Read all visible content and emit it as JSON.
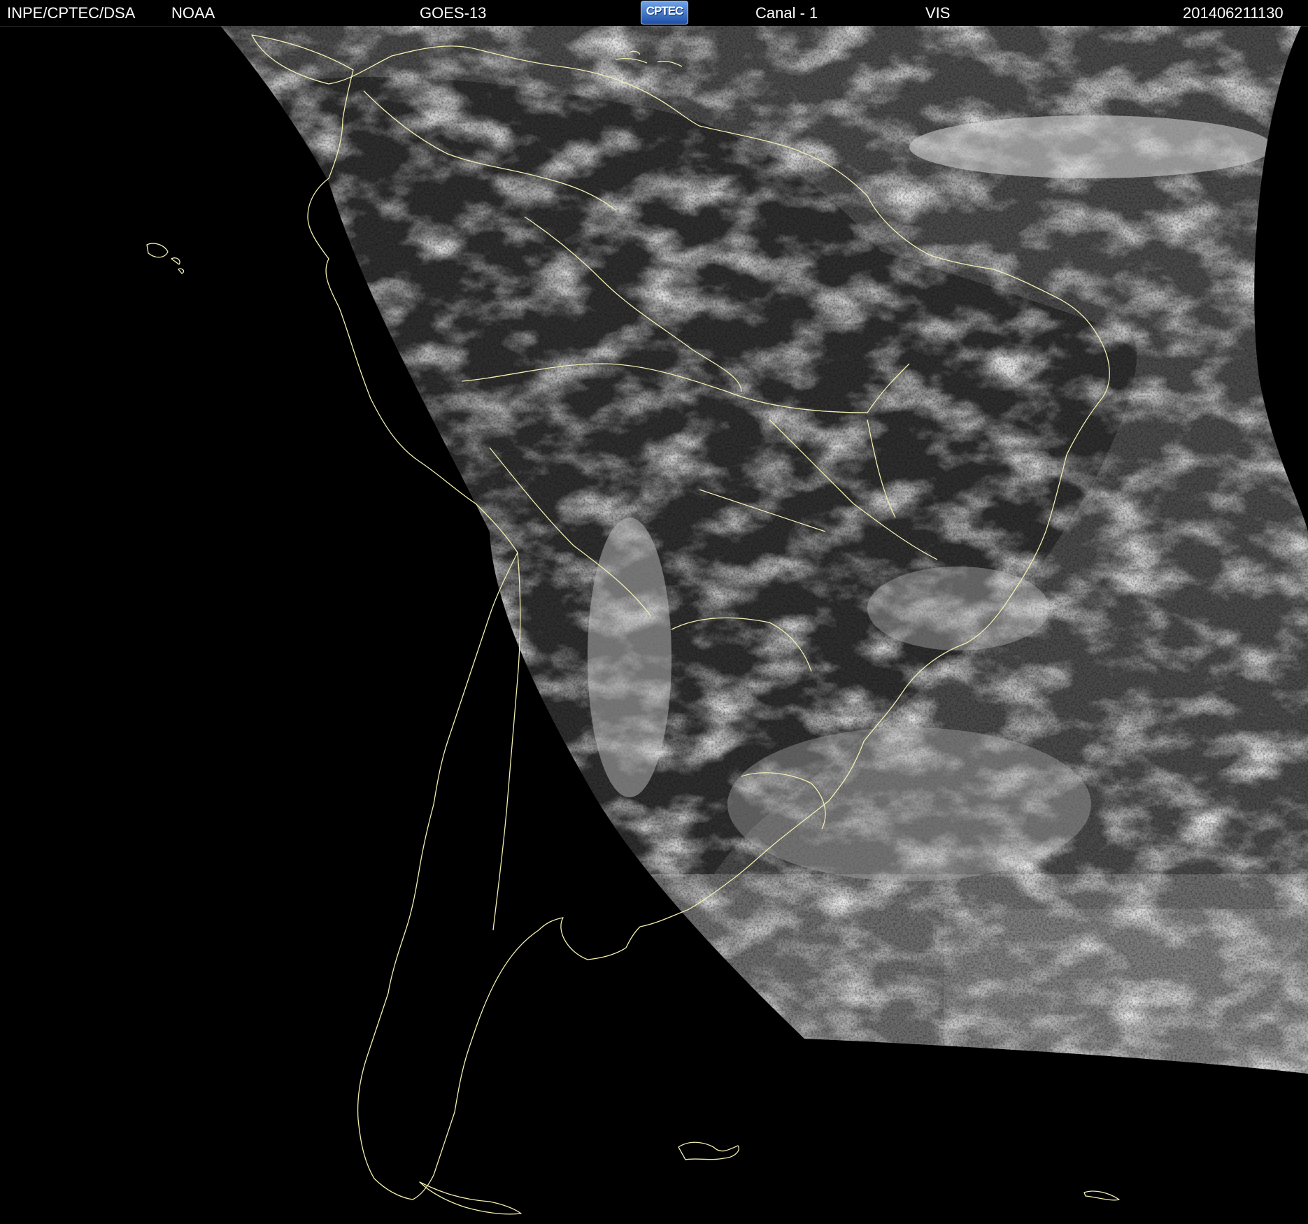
{
  "header": {
    "institution": "INPE/CPTEC/DSA",
    "agency": "NOAA",
    "satellite": "GOES-13",
    "logo_text": "CPTEC",
    "channel": "Canal - 1",
    "band": "VIS",
    "timestamp": "201406211130"
  },
  "colors": {
    "background": "#000000",
    "coastline": "#f2efb0",
    "header_text": "#ffffff",
    "cloud": "#e8e8e8",
    "land_dark": "#2b2b2b",
    "ocean_grey": "#4a4a4a"
  }
}
